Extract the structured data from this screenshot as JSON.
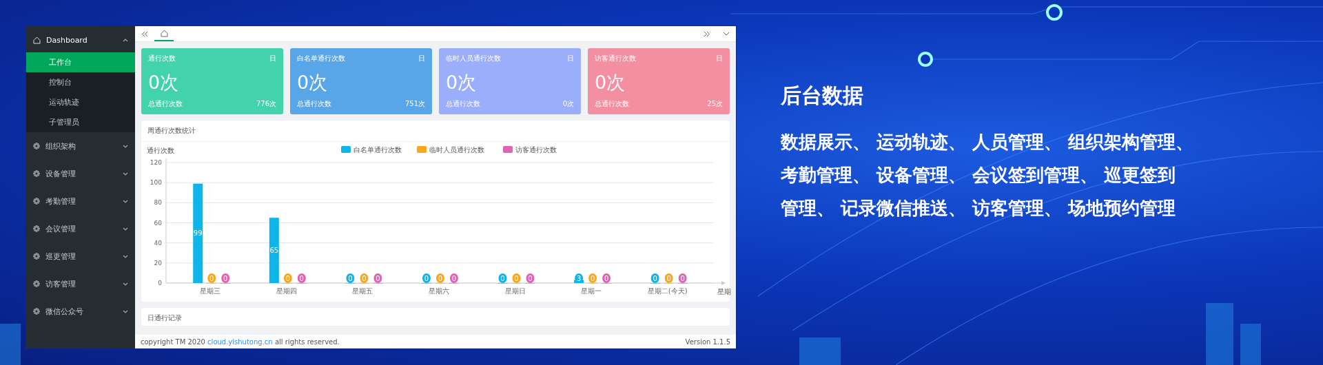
{
  "sidebar": {
    "items": [
      {
        "label": "Dashboard",
        "kind": "home",
        "expanded": true,
        "children": [
          {
            "label": "工作台",
            "selected": true
          },
          {
            "label": "控制台",
            "selected": false
          },
          {
            "label": "运动轨迹",
            "selected": false
          },
          {
            "label": "子管理员",
            "selected": false
          }
        ]
      },
      {
        "label": "组织架构",
        "kind": "gear",
        "expanded": false
      },
      {
        "label": "设备管理",
        "kind": "gear",
        "expanded": false
      },
      {
        "label": "考勤管理",
        "kind": "gear",
        "expanded": false
      },
      {
        "label": "会议管理",
        "kind": "gear",
        "expanded": false
      },
      {
        "label": "巡更管理",
        "kind": "gear",
        "expanded": false
      },
      {
        "label": "访客管理",
        "kind": "gear",
        "expanded": false
      },
      {
        "label": "微信公众号",
        "kind": "gear",
        "expanded": false
      }
    ]
  },
  "stat_cards": [
    {
      "title": "通行次数",
      "period": "日",
      "value": "0次",
      "total_label": "总通行次数",
      "total": "776次",
      "color": "#42d3ac"
    },
    {
      "title": "白名单通行次数",
      "period": "日",
      "value": "0次",
      "total_label": "总通行次数",
      "total": "751次",
      "color": "#58a6e8"
    },
    {
      "title": "临时人员通行次数",
      "period": "日",
      "value": "0次",
      "total_label": "总通行次数",
      "total": "0次",
      "color": "#9aaefc"
    },
    {
      "title": "访客通行次数",
      "period": "日",
      "value": "0次",
      "total_label": "总通行次数",
      "total": "25次",
      "color": "#f48fa1"
    }
  ],
  "weekly_panel": {
    "title": "周通行次数统计",
    "chart_data": {
      "type": "bar",
      "ylabel": "通行次数",
      "xlabel": "星期",
      "categories": [
        "星期三",
        "星期四",
        "星期五",
        "星期六",
        "星期日",
        "星期一",
        "星期二(今天)"
      ],
      "ylim": [
        0,
        120
      ],
      "grid": true,
      "legend": true,
      "yticks": [
        0,
        20,
        40,
        60,
        80,
        100,
        120
      ],
      "data_labels": true,
      "series": [
        {
          "name": "白名单通行次数",
          "color": "#0fb4e8",
          "values": [
            99,
            65,
            0,
            0,
            0,
            3,
            0
          ]
        },
        {
          "name": "临时人员通行次数",
          "color": "#f9a71c",
          "values": [
            0,
            0,
            0,
            0,
            0,
            0,
            0
          ]
        },
        {
          "name": "访客通行次数",
          "color": "#e063b4",
          "values": [
            0,
            0,
            0,
            0,
            0,
            0,
            0
          ]
        }
      ]
    }
  },
  "daily_panel": {
    "title": "日通行记录"
  },
  "footer": {
    "copyright": "copyright TM 2020",
    "link": "cloud.yishutong.cn",
    "rights": "all rights reserved.",
    "version": "Version 1.1.5"
  },
  "promo": {
    "title": "后台数据",
    "lines": [
      "数据展示、 运动轨迹、 人员管理、 组织架构管理、",
      "考勤管理、 设备管理、 会议签到管理、 巡更签到",
      "管理、 记录微信推送、 访客管理、 场地预约管理"
    ]
  }
}
